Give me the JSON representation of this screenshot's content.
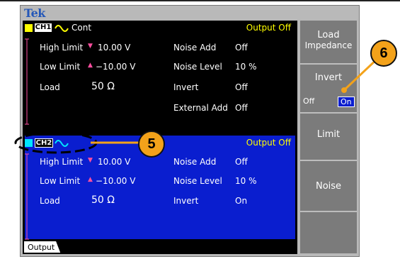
{
  "brand": "Tek",
  "colors": {
    "ch1": "#ffff00",
    "ch2": "#00e5ff",
    "ch1_panel": "#000000",
    "ch2_panel": "#0a1ecf",
    "status": "#ffff00",
    "menu_bg": "#7b7b7b",
    "callout": "#f3a21a"
  },
  "ch1": {
    "label": "CH1",
    "wave_icon": "sine-wave-icon",
    "mode": "Cont",
    "output_status": "Output Off",
    "rows": [
      {
        "label": "High Limit",
        "value": "10.00 V",
        "param": "Noise Add",
        "param_value": "Off"
      },
      {
        "label": "Low Limit",
        "value": "−10.00 V",
        "param": "Noise Level",
        "param_value": "10 %"
      },
      {
        "label": "Load",
        "value": "50 Ω",
        "param": "Invert",
        "param_value": "Off"
      },
      {
        "label": "",
        "value": "",
        "param": "External Add",
        "param_value": "Off"
      }
    ]
  },
  "ch2": {
    "label": "CH2",
    "wave_icon": "sine-wave-icon",
    "output_status": "Output Off",
    "rows": [
      {
        "label": "High Limit",
        "value": "10.00 V",
        "param": "Noise Add",
        "param_value": "Off"
      },
      {
        "label": "Low Limit",
        "value": "−10.00 V",
        "param": "Noise Level",
        "param_value": "10 %"
      },
      {
        "label": "Load",
        "value": "50 Ω",
        "param": "Invert",
        "param_value": "On"
      }
    ]
  },
  "tab": "Output",
  "menu": {
    "load_line1": "Load",
    "load_line2": "Impedance",
    "invert": "Invert",
    "invert_off": "Off",
    "invert_on": "On",
    "limit": "Limit",
    "noise": "Noise"
  },
  "callouts": {
    "five": "5",
    "six": "6"
  }
}
